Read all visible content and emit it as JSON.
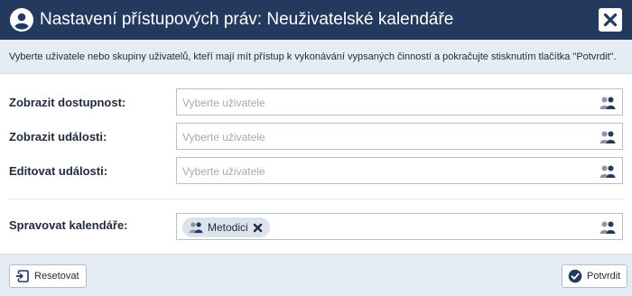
{
  "dialog": {
    "title": "Nastavení přístupových práv: Neuživatelské kalendáře",
    "title_icon": "user-circle-icon",
    "close_icon": "close-icon",
    "info": "Vyberte uživatele nebo skupiny uživatelů, kteří mají mít přístup k vykonávání vypsaných činností a pokračujte stisknutím tlačítka \"Potvrdit\"."
  },
  "rows": [
    {
      "label": "Zobrazit dostupnost:",
      "placeholder": "Vyberte uživatele",
      "icon": "users-icon"
    },
    {
      "label": "Zobrazit události:",
      "placeholder": "Vyberte uživatele",
      "icon": "users-icon"
    },
    {
      "label": "Editovat události:",
      "placeholder": "Vyberte uživatele",
      "icon": "users-icon"
    },
    {
      "label": "Spravovat kalendáře:",
      "chips": [
        {
          "label": "Metodici",
          "icon": "group-icon",
          "remove_icon": "remove-icon"
        }
      ],
      "icon": "users-icon"
    }
  ],
  "footer": {
    "reset_label": "Resetovat",
    "reset_icon": "reset-icon",
    "confirm_label": "Potvrdit",
    "confirm_icon": "check-circle-icon"
  },
  "colors": {
    "header_bg": "#233a5e",
    "panel_bg": "#e6ecf3",
    "chip_bg": "#dce3ec",
    "placeholder": "#a4abb5"
  }
}
